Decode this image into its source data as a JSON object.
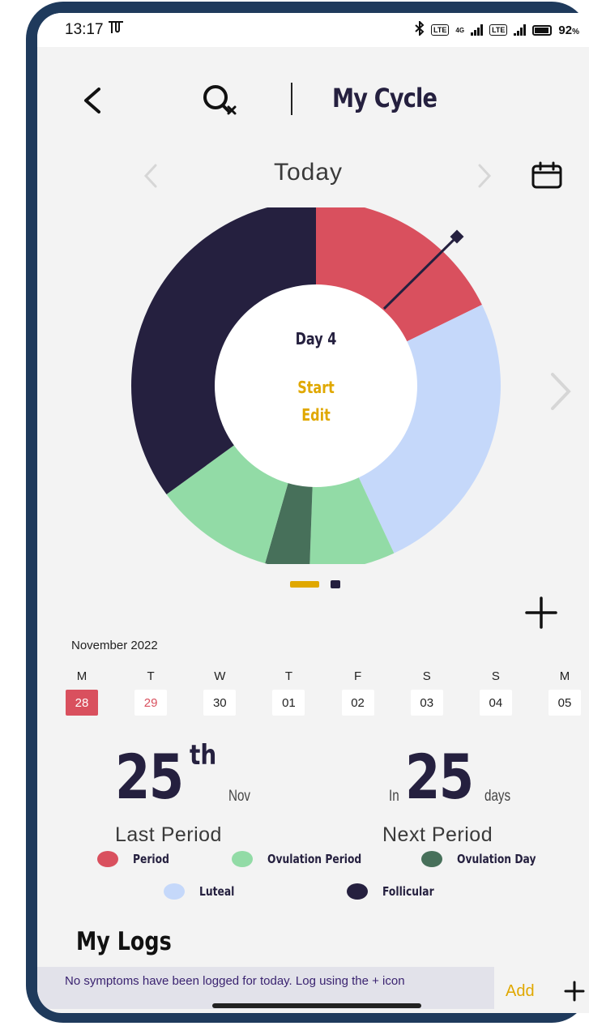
{
  "status_bar": {
    "time": "13:17",
    "network": "4G",
    "battery": "92",
    "battery_unit": "%"
  },
  "header": {
    "title": "My Cycle"
  },
  "date_nav": {
    "label": "Today"
  },
  "cycle_chart": {
    "day_label": "Day 4",
    "start_label": "Start",
    "edit_label": "Edit",
    "segment_colors": {
      "period": "#d9505e",
      "luteal": "#c5d8fa",
      "ovulation_period": "#92dba6",
      "ovulation_day": "#47705a",
      "follicular": "#25203f"
    }
  },
  "calendar": {
    "month": "November 2022",
    "days": [
      {
        "dow": "M",
        "num": "28",
        "state": "today"
      },
      {
        "dow": "T",
        "num": "29",
        "state": "period"
      },
      {
        "dow": "W",
        "num": "30",
        "state": "normal"
      },
      {
        "dow": "T",
        "num": "01",
        "state": "normal"
      },
      {
        "dow": "F",
        "num": "02",
        "state": "normal"
      },
      {
        "dow": "S",
        "num": "03",
        "state": "normal"
      },
      {
        "dow": "S",
        "num": "04",
        "state": "normal"
      },
      {
        "dow": "M",
        "num": "05",
        "state": "normal"
      }
    ]
  },
  "stats": {
    "last_period_day": "25",
    "last_period_suffix": "th",
    "last_period_month": "Nov",
    "last_period_caption": "Last Period",
    "next_prefix": "In",
    "next_period_days": "25",
    "next_suffix": "days",
    "next_period_caption": "Next Period"
  },
  "legend": [
    {
      "label": "Period",
      "color": "#d9505e"
    },
    {
      "label": "Ovulation Period",
      "color": "#92dba6"
    },
    {
      "label": "Ovulation Day",
      "color": "#47705a"
    },
    {
      "label": "Luteal",
      "color": "#c5d8fa"
    },
    {
      "label": "Follicular",
      "color": "#25203f"
    }
  ],
  "logs": {
    "title": "My Logs",
    "empty_message": "No symptoms have been logged for today. Log using the + icon",
    "add_label": "Add"
  }
}
